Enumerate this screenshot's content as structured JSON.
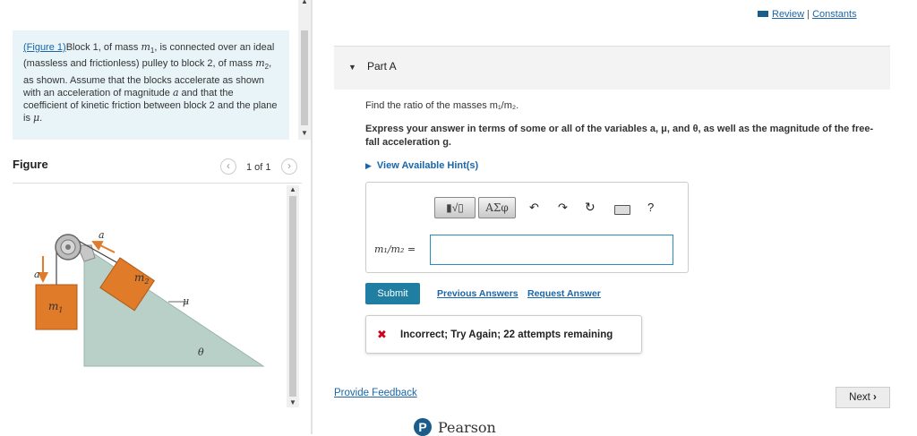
{
  "top_links": {
    "review": "Review",
    "separator": "|",
    "constants": "Constants"
  },
  "problem": {
    "figure_link": "(Figure 1)",
    "text_parts": [
      "Block 1, of mass ",
      "m",
      "1",
      ", is connected over an ideal (massless and frictionless) pulley to block 2, of mass ",
      "m",
      "2",
      ", as shown. Assume that the blocks accelerate as shown with an acceleration of magnitude ",
      "a",
      " and that the coefficient of kinetic friction between block 2 and the plane is ",
      "μ",
      "."
    ]
  },
  "figure": {
    "label": "Figure",
    "pager": "1 of 1",
    "prev_icon": "chevron-left-icon",
    "next_icon": "chevron-right-icon",
    "labels": {
      "accel": "a",
      "block1": "m",
      "block1_sub": "1",
      "block2": "m",
      "block2_sub": "2",
      "mu": "μ",
      "theta": "θ"
    }
  },
  "part": {
    "title": "Part A"
  },
  "question": {
    "prompt": "Find the ratio of the masses m₁/m₂.",
    "express": "Express your answer in terms of some or all of the variables a, μ, and θ, as well as the magnitude of the free-fall acceleration g.",
    "hint": "View Available Hint(s)"
  },
  "answer": {
    "toolbar": {
      "templates": "▮√▯",
      "greek": "ΑΣφ",
      "help": "?"
    },
    "label": "m₁/m₂ =",
    "value": ""
  },
  "actions": {
    "submit": "Submit",
    "previous_answers": "Previous Answers",
    "request_answer": "Request Answer"
  },
  "feedback": {
    "icon": "✖",
    "text": "Incorrect; Try Again; 22 attempts remaining"
  },
  "footer": {
    "provide_feedback": "Provide Feedback",
    "next": "Next",
    "next_icon": "›",
    "brand": "Pearson",
    "brand_initial": "P"
  },
  "colors": {
    "accent": "#1f7ea1",
    "link": "#1a66a8",
    "error": "#d0021b",
    "block": "#e07b2a",
    "plane": "#b9d0c8",
    "problem_bg": "#e8f4f7"
  }
}
